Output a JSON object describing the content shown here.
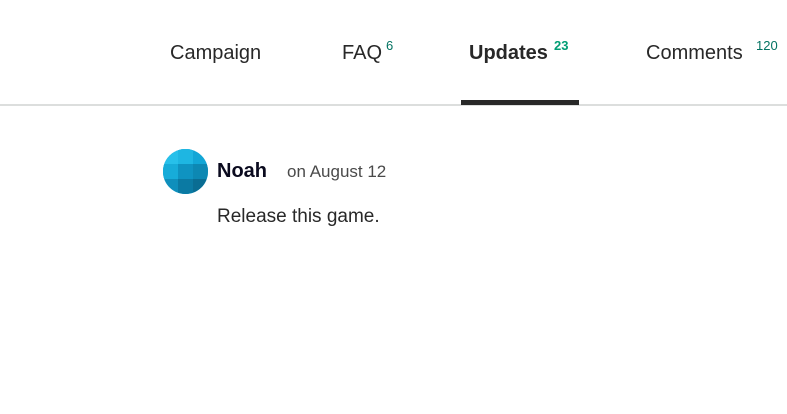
{
  "tabs": [
    {
      "label": "Campaign",
      "count": "",
      "active": false
    },
    {
      "label": "FAQ",
      "count": "6",
      "active": false
    },
    {
      "label": "Updates",
      "count": "23",
      "active": true
    },
    {
      "label": "Comments",
      "count": "120",
      "active": false
    }
  ],
  "update": {
    "author": "Noah",
    "date": "on August 12",
    "body": "Release this game."
  },
  "colors": {
    "accent_count": "#037362",
    "active_count": "#009e74",
    "active_underline": "#282828",
    "divider": "#dcdedd",
    "avatar": "#1c9cc9"
  }
}
